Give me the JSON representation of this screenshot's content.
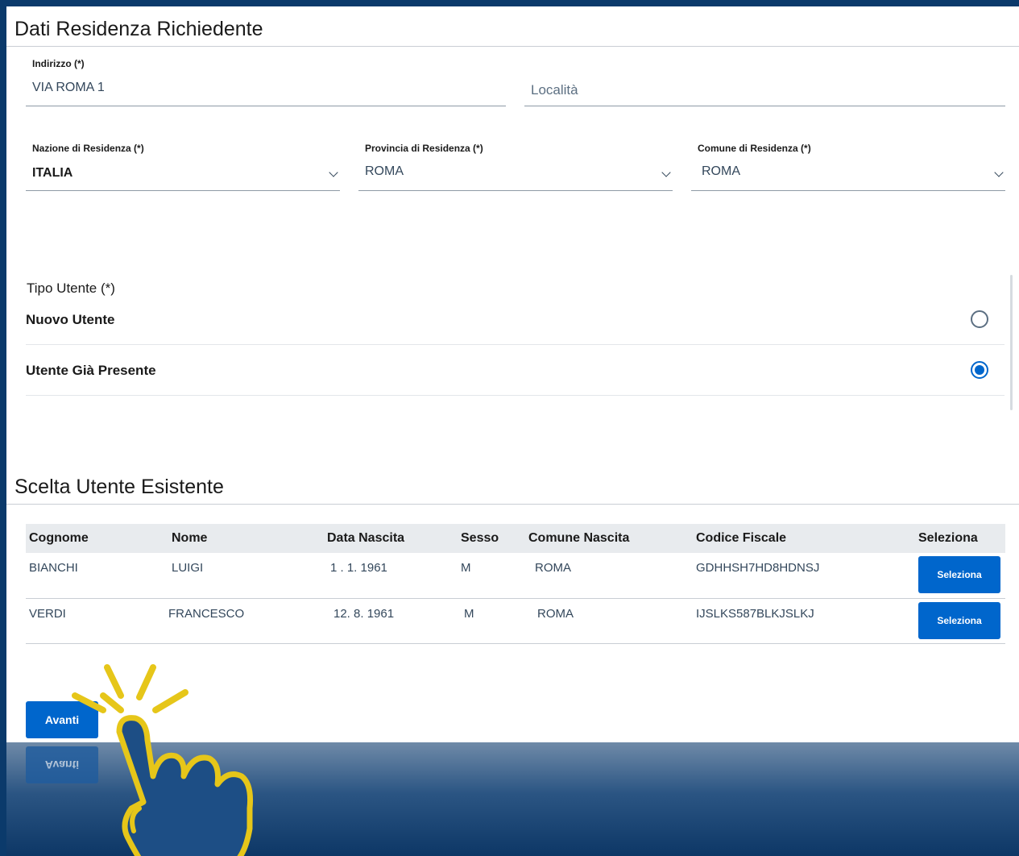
{
  "residence_section": {
    "title": "Dati Residenza Richiedente",
    "address": {
      "label": "Indirizzo (*)",
      "value": "VIA ROMA 1"
    },
    "locality": {
      "placeholder": "Località"
    },
    "country": {
      "label": "Nazione di Residenza (*)",
      "value": "ITALIA"
    },
    "province": {
      "label": "Provincia di Residenza (*)",
      "value": "ROMA"
    },
    "municipality": {
      "label": "Comune di Residenza (*)",
      "value": "ROMA"
    }
  },
  "user_type": {
    "label": "Tipo Utente (*)",
    "options": [
      {
        "label": "Nuovo Utente",
        "checked": false
      },
      {
        "label": "Utente Già Presente",
        "checked": true
      }
    ]
  },
  "existing_user_section": {
    "title": "Scelta Utente Esistente",
    "columns": [
      "Cognome",
      "Nome",
      "Data Nascita",
      "Sesso",
      "Comune Nascita",
      "Codice Fiscale",
      "Seleziona"
    ],
    "rows": [
      {
        "cognome": "BIANCHI",
        "nome": "LUIGI",
        "data_nascita": "1 . 1. 1961",
        "sesso": "M",
        "comune_nascita": "ROMA",
        "codice_fiscale": "GDHHSH7HD8HDNSJ",
        "button": "Seleziona"
      },
      {
        "cognome": "VERDI",
        "nome": "FRANCESCO",
        "data_nascita": "12. 8. 1961",
        "sesso": "M",
        "comune_nascita": "ROMA",
        "codice_fiscale": "IJSLKS587BLKJSLKJ",
        "button": "Seleziona"
      }
    ]
  },
  "next_button": {
    "label": "Avanti"
  },
  "colors": {
    "primary": "#0066cc",
    "hand_outline": "#e6c619",
    "footer_dark": "#0d3766"
  }
}
